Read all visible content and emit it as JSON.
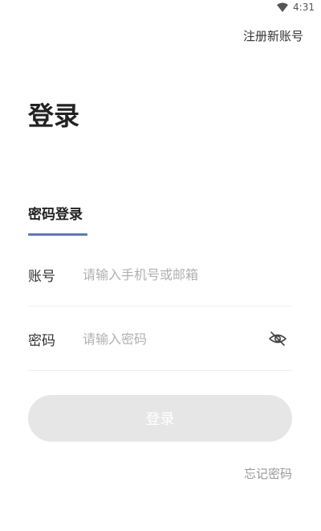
{
  "status_bar": {
    "time": "4:31",
    "wifi_icon": "wifi-icon"
  },
  "header": {
    "register_link": "注册新账号"
  },
  "page": {
    "title": "登录"
  },
  "tabs": [
    {
      "label": "密码登录",
      "active": true
    }
  ],
  "form": {
    "account": {
      "label": "账号",
      "placeholder": "请输入手机号或邮箱",
      "value": ""
    },
    "password": {
      "label": "密码",
      "placeholder": "请输入密码",
      "value": "",
      "toggle_icon": "eye-off-icon"
    },
    "submit_label": "登录",
    "forgot_link": "忘记密码"
  },
  "colors": {
    "accent": "#5b78b8",
    "button_disabled_bg": "#e6e6e6",
    "button_text": "#ffffff",
    "placeholder": "#b0b0b0"
  }
}
